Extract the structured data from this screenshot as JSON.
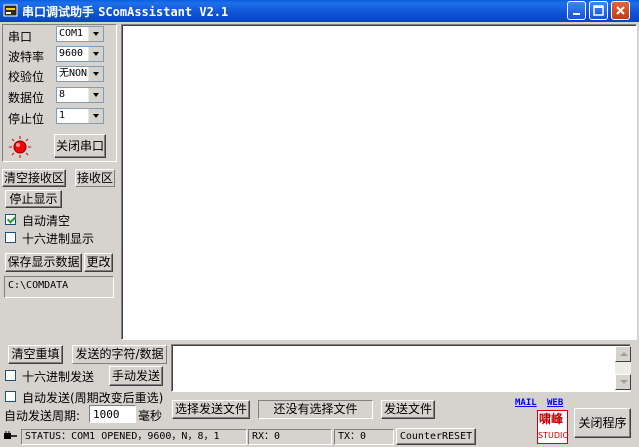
{
  "window": {
    "title_cn": "串口调试助手",
    "title_en": "SComAssistant V2.1",
    "icons": {
      "app": "serial-app-icon",
      "minimize": "minimize-icon",
      "maximize": "maximize-icon",
      "close": "close-icon"
    }
  },
  "settings": {
    "port_label": "串口",
    "port_value": "COM1",
    "baud_label": "波特率",
    "baud_value": "9600",
    "parity_label": "校验位",
    "parity_value": "无NONE",
    "databits_label": "数据位",
    "databits_value": "8",
    "stopbits_label": "停止位",
    "stopbits_value": "1",
    "indicator_icon": "red-led-icon",
    "indicator_color": "#ff0000",
    "close_port_button": "关闭串口"
  },
  "receive": {
    "clear_button": "清空接收区",
    "area_label": "接收区",
    "stop_display_button": "停止显示",
    "auto_clear_label": "自动清空",
    "auto_clear_checked": true,
    "hex_display_label": "十六进制显示",
    "hex_display_checked": false,
    "save_button": "保存显示数据",
    "change_button": "更改",
    "save_path": "C:\\COMDATA",
    "text": ""
  },
  "send": {
    "clear_button": "清空重填",
    "area_label": "发送的字符/数据",
    "hex_send_label": "十六进制发送",
    "hex_send_checked": false,
    "manual_send_button": "手动发送",
    "auto_send_label": "自动发送(周期改变后重选)",
    "auto_send_checked": false,
    "period_label": "自动发送周期:",
    "period_value": "1000",
    "period_unit": "毫秒",
    "select_file_button": "选择发送文件",
    "file_status": "还没有选择文件",
    "send_file_button": "发送文件",
    "text": ""
  },
  "links": {
    "mail": "MAIL",
    "web": "WEB"
  },
  "logo": {
    "top": "啸峰",
    "bottom": "STUDIO"
  },
  "exit_button": "关闭程序",
  "statusbar": {
    "status": "STATUS：COM1 OPENED，9600，N，8，1",
    "rx": "RX：0",
    "tx": "TX：0",
    "reset_button": "CounterRESET",
    "icon": "status-plug-icon"
  }
}
